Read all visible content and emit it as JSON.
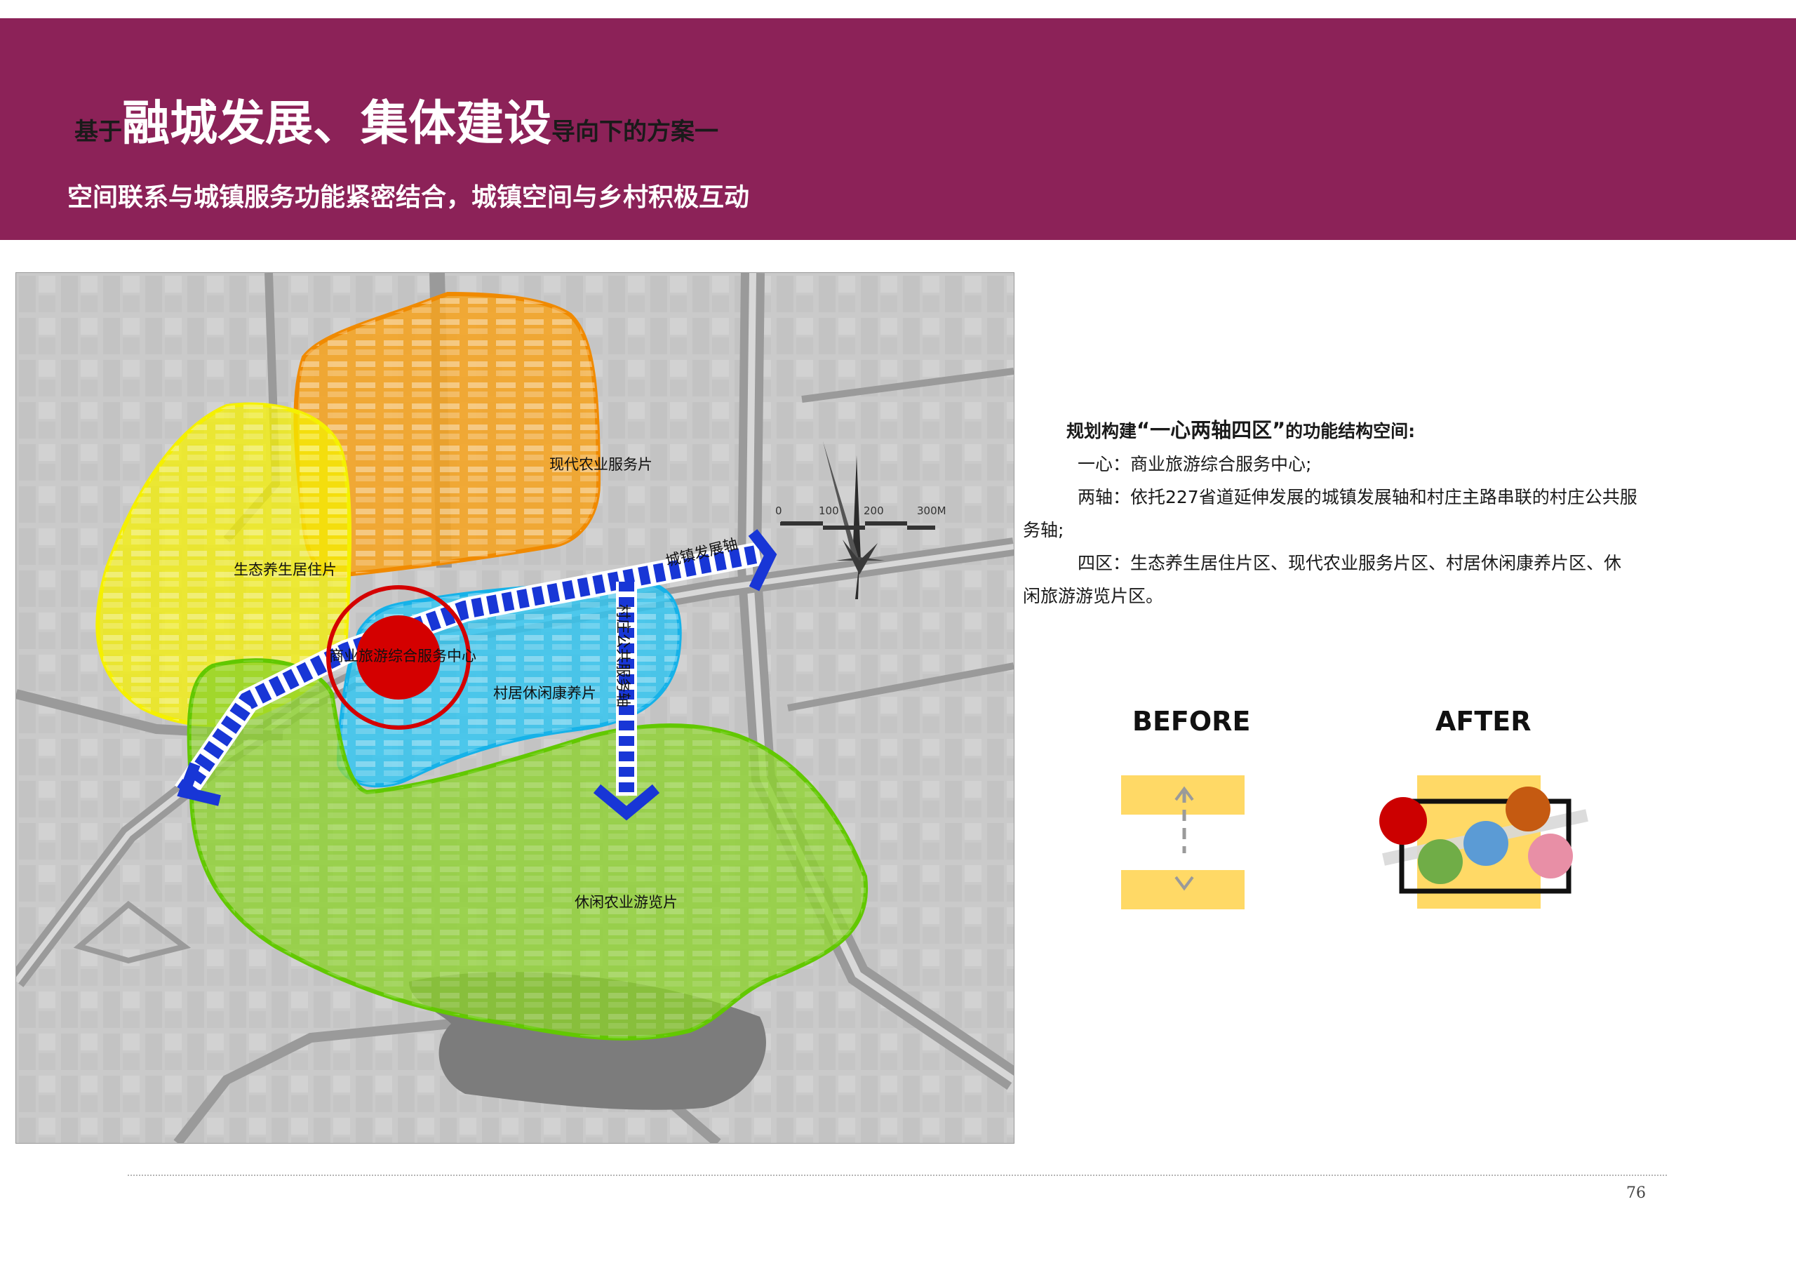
{
  "header": {
    "title_prefix": "基于",
    "title_main": "融城发展、集体建设",
    "title_suffix": "导向下的方案一",
    "subtitle": "空间联系与城镇服务功能紧密结合，城镇空间与乡村积极互动",
    "banner_color": "#8c2258"
  },
  "map": {
    "zones": [
      {
        "label": "生态养生居住片",
        "color": "#f5f000"
      },
      {
        "label": "现代农业服务片",
        "color": "#f7a21b"
      },
      {
        "label": "村居休闲康养片",
        "color": "#2ec4f0"
      },
      {
        "label": "休闲农业游览片",
        "color": "#8cd22a"
      }
    ],
    "center_label": "商业旅游综合服务中心",
    "axis_town": "城镇发展轴",
    "axis_village": "村庄公共服务轴",
    "axis_color": "#1836d6",
    "center_color": "#d40000",
    "scale": {
      "t0": "0",
      "t1": "100",
      "t2": "200",
      "t3": "300M"
    },
    "compass_icon": "north-arrow-icon"
  },
  "description": {
    "heading_prefix": "规划构建",
    "heading_em": "“一心两轴四区”",
    "heading_suffix": "的功能结构空间",
    "heading_colon": ":",
    "line1": "一心：商业旅游综合服务中心;",
    "line2_a": "两轴：依托227省道延伸发展的城镇发展轴和村庄主路串联的村庄公共服",
    "line2_b": "务轴;",
    "line3_a": "四区：生态养生居住片区、现代农业服务片区、村居休闲康养片区、休",
    "line3_b": "闲旅游游览片区。"
  },
  "comparison": {
    "before_label": "BEFORE",
    "after_label": "AFTER",
    "band_color": "#ffd966",
    "circle_colors": [
      "#cc0000",
      "#c55a11",
      "#5b9bd5",
      "#70ad47",
      "#e88fa6"
    ]
  },
  "footer": {
    "page_number": "76"
  }
}
